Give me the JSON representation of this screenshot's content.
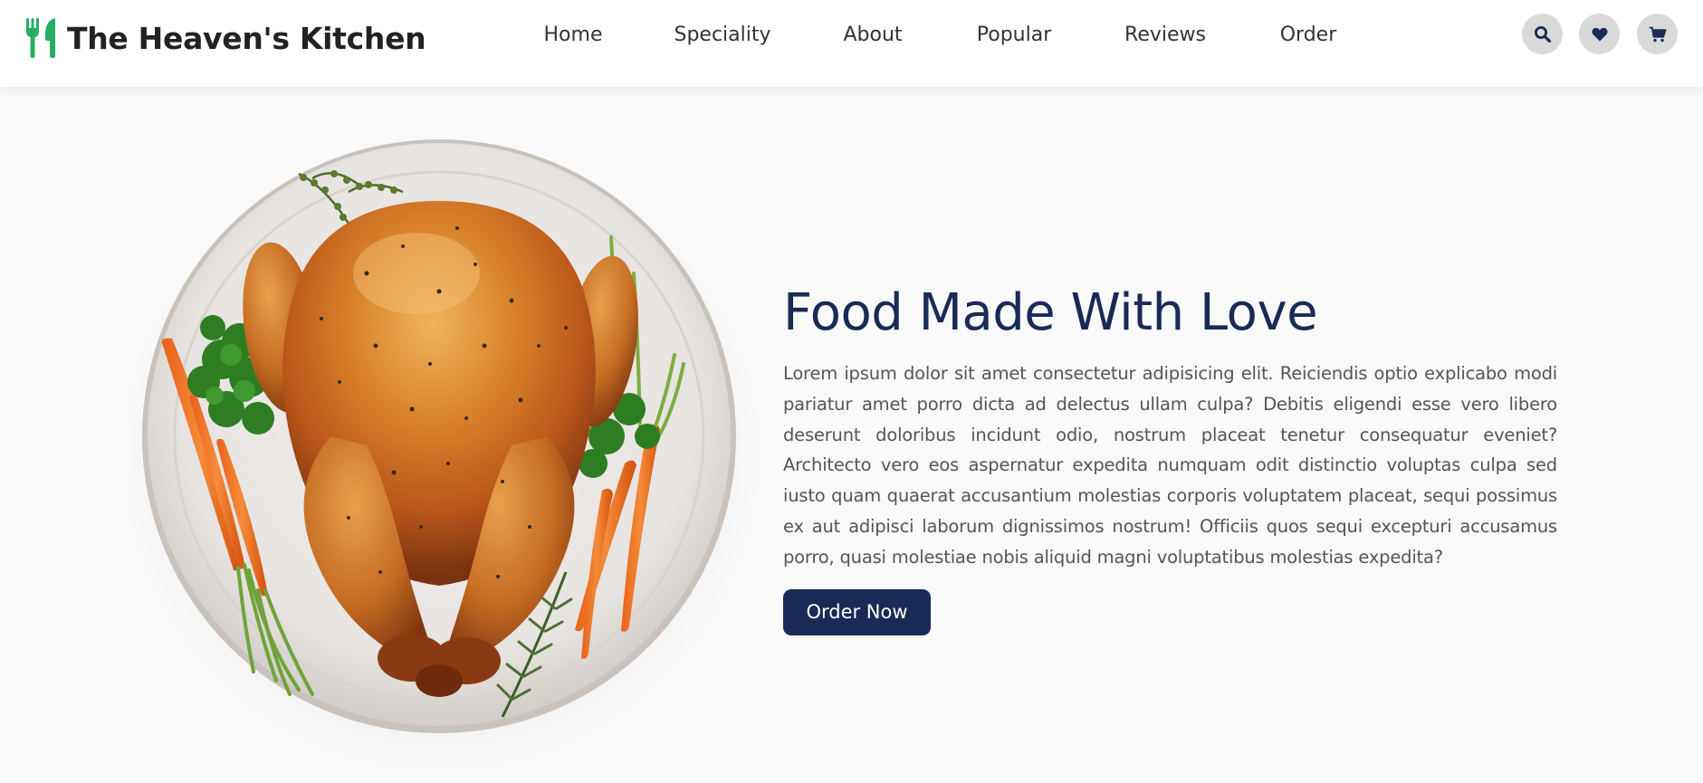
{
  "brand": {
    "name": "The Heaven's Kitchen",
    "icon": "utensils-icon",
    "color": "#27ae60"
  },
  "nav": {
    "items": [
      {
        "label": "Home"
      },
      {
        "label": "Speciality"
      },
      {
        "label": "About"
      },
      {
        "label": "Popular"
      },
      {
        "label": "Reviews"
      },
      {
        "label": "Order"
      }
    ]
  },
  "header_actions": [
    {
      "icon": "search-icon"
    },
    {
      "icon": "heart-icon"
    },
    {
      "icon": "shopping-cart-icon"
    }
  ],
  "hero": {
    "title": "Food Made With Love",
    "text": "Lorem ipsum dolor sit amet consectetur adipisicing elit. Reiciendis optio explicabo modi pariatur amet porro dicta ad delectus ullam culpa? Debitis eligendi esse vero libero deserunt doloribus incidunt odio, nostrum placeat tenetur consequatur eveniet? Architecto vero eos aspernatur expedita numquam odit distinctio voluptas culpa sed iusto quam quaerat accusantium molestias corporis voluptatem placeat, sequi possimus ex aut adipisci laborum dignissimos nostrum! Officiis quos sequi excepturi accusamus porro, quasi molestiae nobis aliquid magni voluptatibus molestias expedita?",
    "button_label": "Order Now",
    "image": "roast-chicken-plate"
  },
  "colors": {
    "primary": "#192a56",
    "accent": "#27ae60",
    "icon_bg": "#d9d9d9",
    "text": "#555555"
  }
}
